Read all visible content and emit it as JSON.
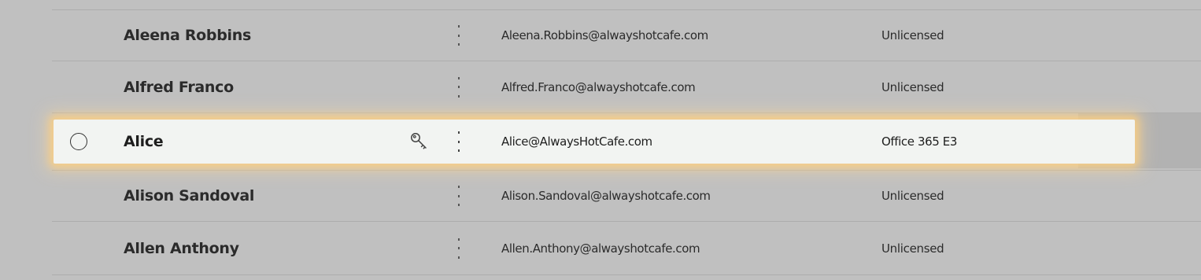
{
  "users": {
    "rows": [
      {
        "name": "Aleena Robbins",
        "email": "Aleena.Robbins@alwayshotcafe.com",
        "license": "Unlicensed"
      },
      {
        "name": "Alfred Franco",
        "email": "Alfred.Franco@alwayshotcafe.com",
        "license": "Unlicensed"
      },
      {
        "name": "Alice",
        "email": "Alice@AlwaysHotCafe.com",
        "license": "Office 365 E3",
        "highlighted": true,
        "icon": "key-icon"
      },
      {
        "name": "Alison Sandoval",
        "email": "Alison.Sandoval@alwayshotcafe.com",
        "license": "Unlicensed"
      },
      {
        "name": "Allen Anthony",
        "email": "Allen.Anthony@alwayshotcafe.com",
        "license": "Unlicensed"
      }
    ]
  },
  "colors": {
    "backdrop": "#c0c0c0",
    "highlight_glow": "#ffcd78",
    "highlight_bg": "#f2f4f2"
  }
}
